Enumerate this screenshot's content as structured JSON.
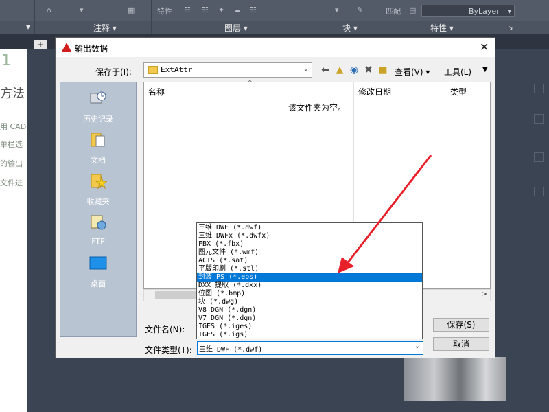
{
  "ribbon": {
    "panels": [
      "注释",
      "图层",
      "块",
      "特性"
    ],
    "top_labels": [
      "特性",
      "匹配"
    ],
    "linetype_value": "ByLayer"
  },
  "background_doc": {
    "heading_fragment": "1",
    "method_fragment": "方法",
    "lines": [
      "用 CAD",
      "单栏选",
      "的输出",
      "文件进"
    ]
  },
  "dialog": {
    "title": "输出数据",
    "look_in_label": "保存于(I):",
    "look_in_value": "ExtAttr",
    "toolbar_view": "查看(V)",
    "toolbar_tools": "工具(L)",
    "places": [
      {
        "label": "历史记录",
        "icon": "history-icon"
      },
      {
        "label": "文档",
        "icon": "documents-icon"
      },
      {
        "label": "收藏夹",
        "icon": "favorites-icon"
      },
      {
        "label": "FTP",
        "icon": "ftp-icon"
      },
      {
        "label": "桌面",
        "icon": "desktop-icon"
      }
    ],
    "columns": {
      "name": "名称",
      "modified": "修改日期",
      "type": "类型"
    },
    "empty_message": "该文件夹为空。",
    "file_name_label": "文件名(N):",
    "file_type_label": "文件类型(T):",
    "file_type_value": "三维 DWF (*.dwf)",
    "save_button": "保存(S)",
    "cancel_button": "取消",
    "file_types": [
      "三维 DWF (*.dwf)",
      "三维 DWFx (*.dwfx)",
      "FBX (*.fbx)",
      "图元文件 (*.wmf)",
      "ACIS (*.sat)",
      "平版印刷 (*.stl)",
      "封装 PS (*.eps)",
      "DXX 提取 (*.dxx)",
      "位图 (*.bmp)",
      "块 (*.dwg)",
      "V8 DGN (*.dgn)",
      "V7 DGN (*.dgn)",
      "IGES (*.iges)",
      "IGES (*.igs)"
    ],
    "selected_index": 6
  },
  "colors": {
    "accent": "#0078d7",
    "annotation": "#e8202a",
    "places_bg": "#b8c4d2"
  }
}
